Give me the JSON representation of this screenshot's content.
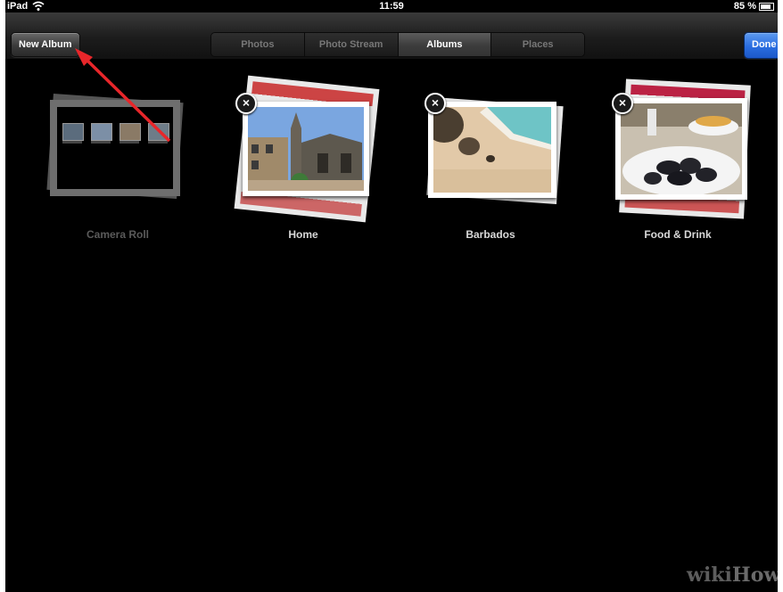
{
  "status_bar": {
    "device": "iPad",
    "time": "11:59",
    "battery": "85 %"
  },
  "nav": {
    "new_album_label": "New Album",
    "done_label": "Done",
    "tabs": [
      {
        "label": "Photos",
        "active": false
      },
      {
        "label": "Photo Stream",
        "active": false
      },
      {
        "label": "Albums",
        "active": true
      },
      {
        "label": "Places",
        "active": false
      }
    ]
  },
  "albums": [
    {
      "name": "Camera Roll",
      "deletable": false
    },
    {
      "name": "Home",
      "deletable": true
    },
    {
      "name": "Barbados",
      "deletable": true
    },
    {
      "name": "Food & Drink",
      "deletable": true
    }
  ],
  "icons": {
    "delete_badge": "×"
  },
  "watermark": {
    "prefix": "wiki",
    "suffix": "How"
  },
  "colors": {
    "done_button": "#2a6de0",
    "annotation_arrow": "#e8262a"
  }
}
